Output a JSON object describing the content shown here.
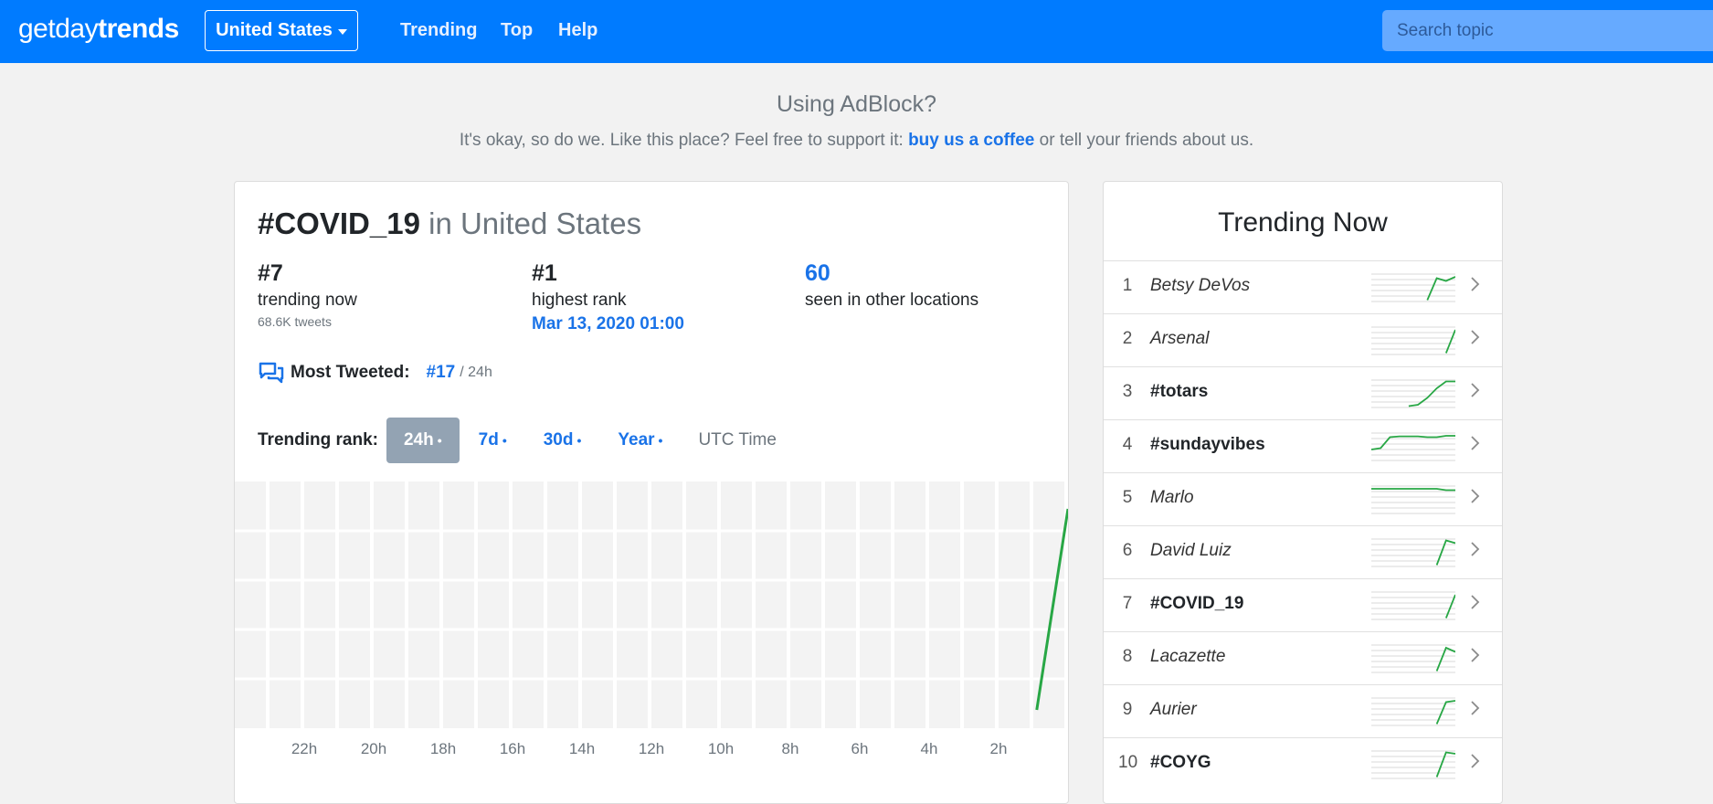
{
  "brand": {
    "part1": "get",
    "part2": "day",
    "part3": "trends"
  },
  "nav": {
    "country": "United States",
    "links": [
      "Trending",
      "Top",
      "Help"
    ]
  },
  "search": {
    "placeholder": "Search topic"
  },
  "adblock": {
    "title": "Using AdBlock?",
    "text_before": "It's okay, so do we. Like this place? Feel free to support it: ",
    "link": "buy us a coffee",
    "text_after": " or tell your friends about us."
  },
  "topic": {
    "name": "#COVID_19",
    "location": "in United States",
    "stats": {
      "trending_now": {
        "value": "#7",
        "label": "trending now",
        "sub": "68.6K tweets"
      },
      "highest_rank": {
        "value": "#1",
        "label": "highest rank",
        "date": "Mar 13, 2020 01:00"
      },
      "other_locations": {
        "value": "60",
        "label": "seen in other locations"
      }
    },
    "most_tweeted": {
      "label": "Most Tweeted:",
      "rank": "#17",
      "period": "/ 24h"
    },
    "rank_tabs": {
      "label": "Trending rank:",
      "tabs": [
        "24h",
        "7d",
        "30d",
        "Year"
      ],
      "active": "24h",
      "utc": "UTC Time"
    }
  },
  "chart_data": {
    "type": "line",
    "x_tick_labels": [
      "22h",
      "20h",
      "18h",
      "16h",
      "14h",
      "12h",
      "10h",
      "8h",
      "6h",
      "4h",
      "2h"
    ],
    "series": [
      {
        "color": "#28a745",
        "points_rank": [
          {
            "hours_ago": 0.9,
            "rank": 51
          },
          {
            "hours_ago": 0,
            "rank": 7
          }
        ]
      }
    ],
    "y_reversed": true,
    "grid": true
  },
  "trending_now": {
    "title": "Trending Now",
    "items": [
      {
        "rank": "1",
        "name": "Betsy DeVos",
        "hashtag": false,
        "spark": [
          null,
          null,
          null,
          null,
          null,
          null,
          0.95,
          0.15,
          0.25,
          0.1
        ]
      },
      {
        "rank": "2",
        "name": "Arsenal",
        "hashtag": false,
        "spark": [
          null,
          null,
          null,
          null,
          null,
          null,
          null,
          null,
          0.95,
          0.1
        ]
      },
      {
        "rank": "3",
        "name": "#totars",
        "hashtag": true,
        "spark": [
          null,
          null,
          null,
          null,
          0.95,
          0.9,
          0.65,
          0.3,
          0.05,
          0.05
        ]
      },
      {
        "rank": "4",
        "name": "#sundayvibes",
        "hashtag": true,
        "spark": [
          0.6,
          0.55,
          0.15,
          0.12,
          0.12,
          0.12,
          0.15,
          0.15,
          0.1,
          0.1
        ]
      },
      {
        "rank": "5",
        "name": "Marlo",
        "hashtag": false,
        "spark": [
          0.1,
          0.1,
          0.1,
          0.1,
          0.1,
          0.1,
          0.1,
          0.1,
          0.15,
          0.15
        ]
      },
      {
        "rank": "6",
        "name": "David Luiz",
        "hashtag": false,
        "spark": [
          null,
          null,
          null,
          null,
          null,
          null,
          null,
          0.95,
          0.05,
          0.15
        ]
      },
      {
        "rank": "7",
        "name": "#COVID_19",
        "hashtag": true,
        "spark": [
          null,
          null,
          null,
          null,
          null,
          null,
          null,
          null,
          0.95,
          0.1
        ]
      },
      {
        "rank": "8",
        "name": "Lacazette",
        "hashtag": false,
        "spark": [
          null,
          null,
          null,
          null,
          null,
          null,
          null,
          0.95,
          0.1,
          0.25
        ]
      },
      {
        "rank": "9",
        "name": "Aurier",
        "hashtag": false,
        "spark": [
          null,
          null,
          null,
          null,
          null,
          null,
          null,
          0.95,
          0.15,
          0.1
        ]
      },
      {
        "rank": "10",
        "name": "#COYG",
        "hashtag": true,
        "spark": [
          null,
          null,
          null,
          null,
          null,
          null,
          null,
          0.95,
          0.05,
          0.1
        ]
      }
    ]
  }
}
